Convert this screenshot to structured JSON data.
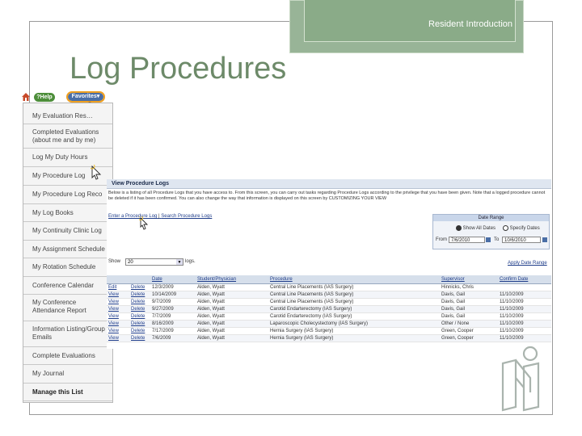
{
  "header": {
    "text": "Resident Introduction"
  },
  "slide": {
    "title": "Log Procedures"
  },
  "menu": {
    "help_label": "?Help",
    "favorites_label": "Favorites▾",
    "items": [
      {
        "label": "My Evaluation Res…",
        "lines": [
          "My Evaluation Res…"
        ]
      },
      {
        "label": "Completed Evaluations (about me and by me)",
        "lines": [
          "Completed Evaluations",
          "(about me and by me)"
        ]
      },
      {
        "label": "Log My Duty Hours",
        "lines": [
          "Log My Duty Hours"
        ]
      },
      {
        "label": "My Procedure Log",
        "lines": [
          "My Procedure Log"
        ]
      },
      {
        "label": "My Procedure Log Reco",
        "lines": [
          "My Procedure Log Reco"
        ]
      },
      {
        "label": "My Log Books",
        "lines": [
          "My Log Books"
        ]
      },
      {
        "label": "My Continuity Clinic Log",
        "lines": [
          "My Continuity Clinic Log"
        ]
      },
      {
        "label": "My Assignment Schedule",
        "lines": [
          "My Assignment Schedule"
        ]
      },
      {
        "label": "My Rotation Schedule",
        "lines": [
          "My Rotation Schedule"
        ]
      },
      {
        "label": "Conference Calendar",
        "lines": [
          "Conference Calendar"
        ]
      },
      {
        "label": "My Conference Attendance Report",
        "lines": [
          "My Conference",
          "Attendance Report"
        ]
      },
      {
        "label": "Information Listing/Group Emails",
        "lines": [
          "Information Listing/Group",
          "Emails"
        ]
      },
      {
        "label": "Complete Evaluations",
        "lines": [
          "Complete Evaluations"
        ]
      },
      {
        "label": "My Journal",
        "lines": [
          "My Journal"
        ]
      },
      {
        "label": "Manage this List",
        "lines": [
          "Manage this List"
        ]
      }
    ]
  },
  "procedure_logs": {
    "title": "View Procedure Logs",
    "description": "Below is a listing of all Procedure Logs that you have access to. From this screen, you can carry out tasks regarding Procedure Logs according to the privilege that you have been given. Note that a logged procedure cannot be deleted if it has been confirmed. You can also change the way that information is displayed on this screen by CUSTOMIZING YOUR VIEW",
    "enter_link": "Enter a Procedure Log",
    "separator": "|",
    "search_link": "Search Procedure Logs",
    "date_range": {
      "title": "Date Range",
      "option_show_all": "Show All Dates",
      "option_specify": "Specify Dates",
      "from_label": "From",
      "from_value": "7/6/2010",
      "to_label": "To",
      "to_value": "10/6/2010"
    },
    "show_label": "Show",
    "show_value": "20",
    "show_suffix": "logs.",
    "apply_link": "Apply Date Range",
    "columns": [
      "Date",
      "Student/Physician",
      "Procedure",
      "Supervisor",
      "Confirm Date"
    ],
    "rows": [
      {
        "action": "Edit",
        "delete": "Delete",
        "date": "12/3/2009",
        "physician": "Alden, Wyatt",
        "procedure": "Central Line Placements (IAS Surgery)",
        "supervisor": "Hinnicks, Chris",
        "confirm": ""
      },
      {
        "action": "View",
        "delete": "Delete",
        "date": "10/14/2009",
        "physician": "Alden, Wyatt",
        "procedure": "Central Line Placements (IAS Surgery)",
        "supervisor": "Davis, Gail",
        "confirm": "11/10/2009"
      },
      {
        "action": "View",
        "delete": "Delete",
        "date": "9/7/2009",
        "physician": "Alden, Wyatt",
        "procedure": "Central Line Placements (IAS Surgery)",
        "supervisor": "Davis, Gail",
        "confirm": "11/10/2009"
      },
      {
        "action": "View",
        "delete": "Delete",
        "date": "9/27/2009",
        "physician": "Alden, Wyatt",
        "procedure": "Carotid Endarterectomy (IAS Surgery)",
        "supervisor": "Davis, Gail",
        "confirm": "11/10/2009"
      },
      {
        "action": "View",
        "delete": "Delete",
        "date": "7/7/2009",
        "physician": "Alden, Wyatt",
        "procedure": "Carotid Endarterectomy (IAS Surgery)",
        "supervisor": "Davis, Gail",
        "confirm": "11/10/2009"
      },
      {
        "action": "View",
        "delete": "Delete",
        "date": "8/16/2009",
        "physician": "Alden, Wyatt",
        "procedure": "Laparoscopic Cholecystectomy (IAS Surgery)",
        "supervisor": "Other / None",
        "confirm": "11/10/2009"
      },
      {
        "action": "View",
        "delete": "Delete",
        "date": "7/17/2009",
        "physician": "Alden, Wyatt",
        "procedure": "Hernia Surgery (IAS Surgery)",
        "supervisor": "Green, Cooper",
        "confirm": "11/10/2009"
      },
      {
        "action": "View",
        "delete": "Delete",
        "date": "7/6/2009",
        "physician": "Alden, Wyatt",
        "procedure": "Hernia Surgery (IAS Surgery)",
        "supervisor": "Green, Cooper",
        "confirm": "11/10/2009"
      }
    ]
  },
  "colors": {
    "title": "#6d8a69",
    "header_box": "#8aab88",
    "link": "#1f3d8a",
    "favorites": "#4a6ea6",
    "help": "#4d8e3a"
  }
}
